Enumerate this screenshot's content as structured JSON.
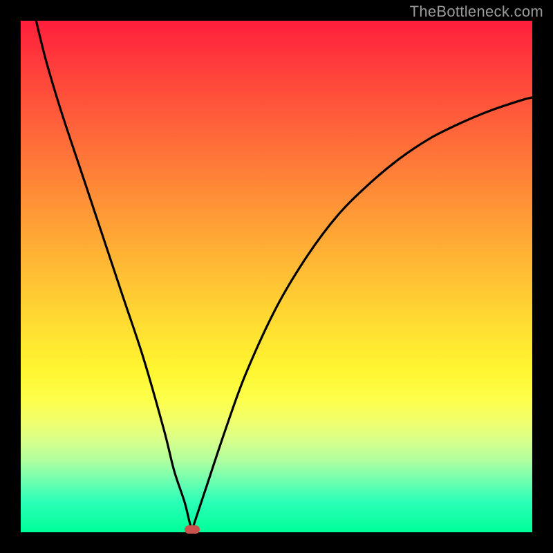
{
  "watermark": "TheBottleneck.com",
  "chart_data": {
    "type": "line",
    "title": "",
    "xlabel": "",
    "ylabel": "",
    "xlim": [
      0,
      100
    ],
    "ylim": [
      0,
      100
    ],
    "grid": false,
    "legend": false,
    "series": [
      {
        "name": "curve",
        "x": [
          3,
          5,
          8,
          12,
          16,
          20,
          24,
          28,
          30,
          32,
          33,
          33.5,
          34,
          36,
          40,
          44,
          50,
          56,
          62,
          68,
          74,
          80,
          86,
          92,
          98,
          100
        ],
        "y": [
          100,
          92,
          82,
          70,
          58,
          46,
          34,
          20,
          12,
          6,
          2,
          0.5,
          2,
          8,
          20,
          31,
          44,
          54,
          62,
          68,
          73,
          77,
          80,
          82.5,
          84.5,
          85
        ]
      }
    ],
    "marker": {
      "x": 33.5,
      "y": 0.5,
      "color": "#c9524d"
    },
    "background_gradient": {
      "top_color": "#ff1e3c",
      "bottom_color": "#00ff99"
    }
  }
}
